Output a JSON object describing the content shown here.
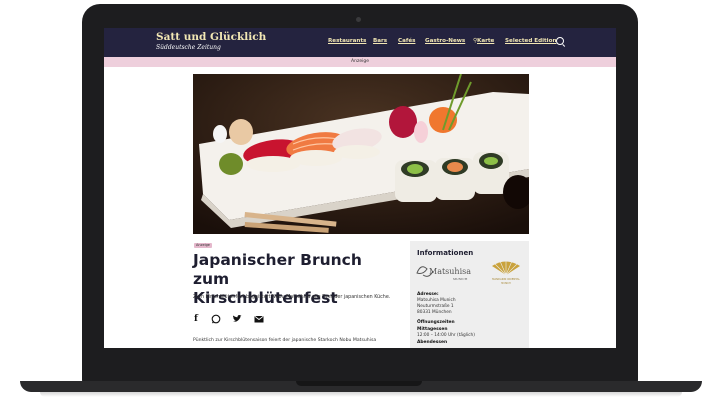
{
  "header": {
    "title": "Satt und Glücklich",
    "subtitle": "Süddeutsche Zeitung",
    "nav": [
      "Restaurants",
      "Bars",
      "Cafés",
      "Gastro-News",
      "Karte",
      "Selected Edition"
    ]
  },
  "ad_bar": "Anzeige",
  "article": {
    "badge": "Anzeige",
    "headline_line1": "Japanischer Brunch zum",
    "headline_line2": "Kirschblütenfest",
    "intro": "Zum Kirschblütenfest begeistert Nobu Matsuhisa alle Fans der japanischen Küche.",
    "body": "Pünktlich zur Kirschblütensaison feiert der japanische Starkoch Nobu Matsuhisa"
  },
  "info": {
    "title": "Informationen",
    "logo_left": "Matsuhisa",
    "logo_left_sub": "MUNICH",
    "logo_right": "MANDARIN ORIENTAL",
    "logo_right_sub": "MUNICH",
    "address_label": "Adresse:",
    "address": [
      "Matsuhisa Munich",
      "Neuturmstraße 1",
      "80331 München"
    ],
    "hours_label": "Öffnungszeiten",
    "hours_sub1": "Mittagessen",
    "hours_time1": "12:00 – 14:00 Uhr (täglich)",
    "hours_sub2": "Abendessen"
  },
  "colors": {
    "header_bg": "#24233f",
    "accent_gold": "#f2e7b4",
    "ad_pink": "#eecfdc"
  }
}
